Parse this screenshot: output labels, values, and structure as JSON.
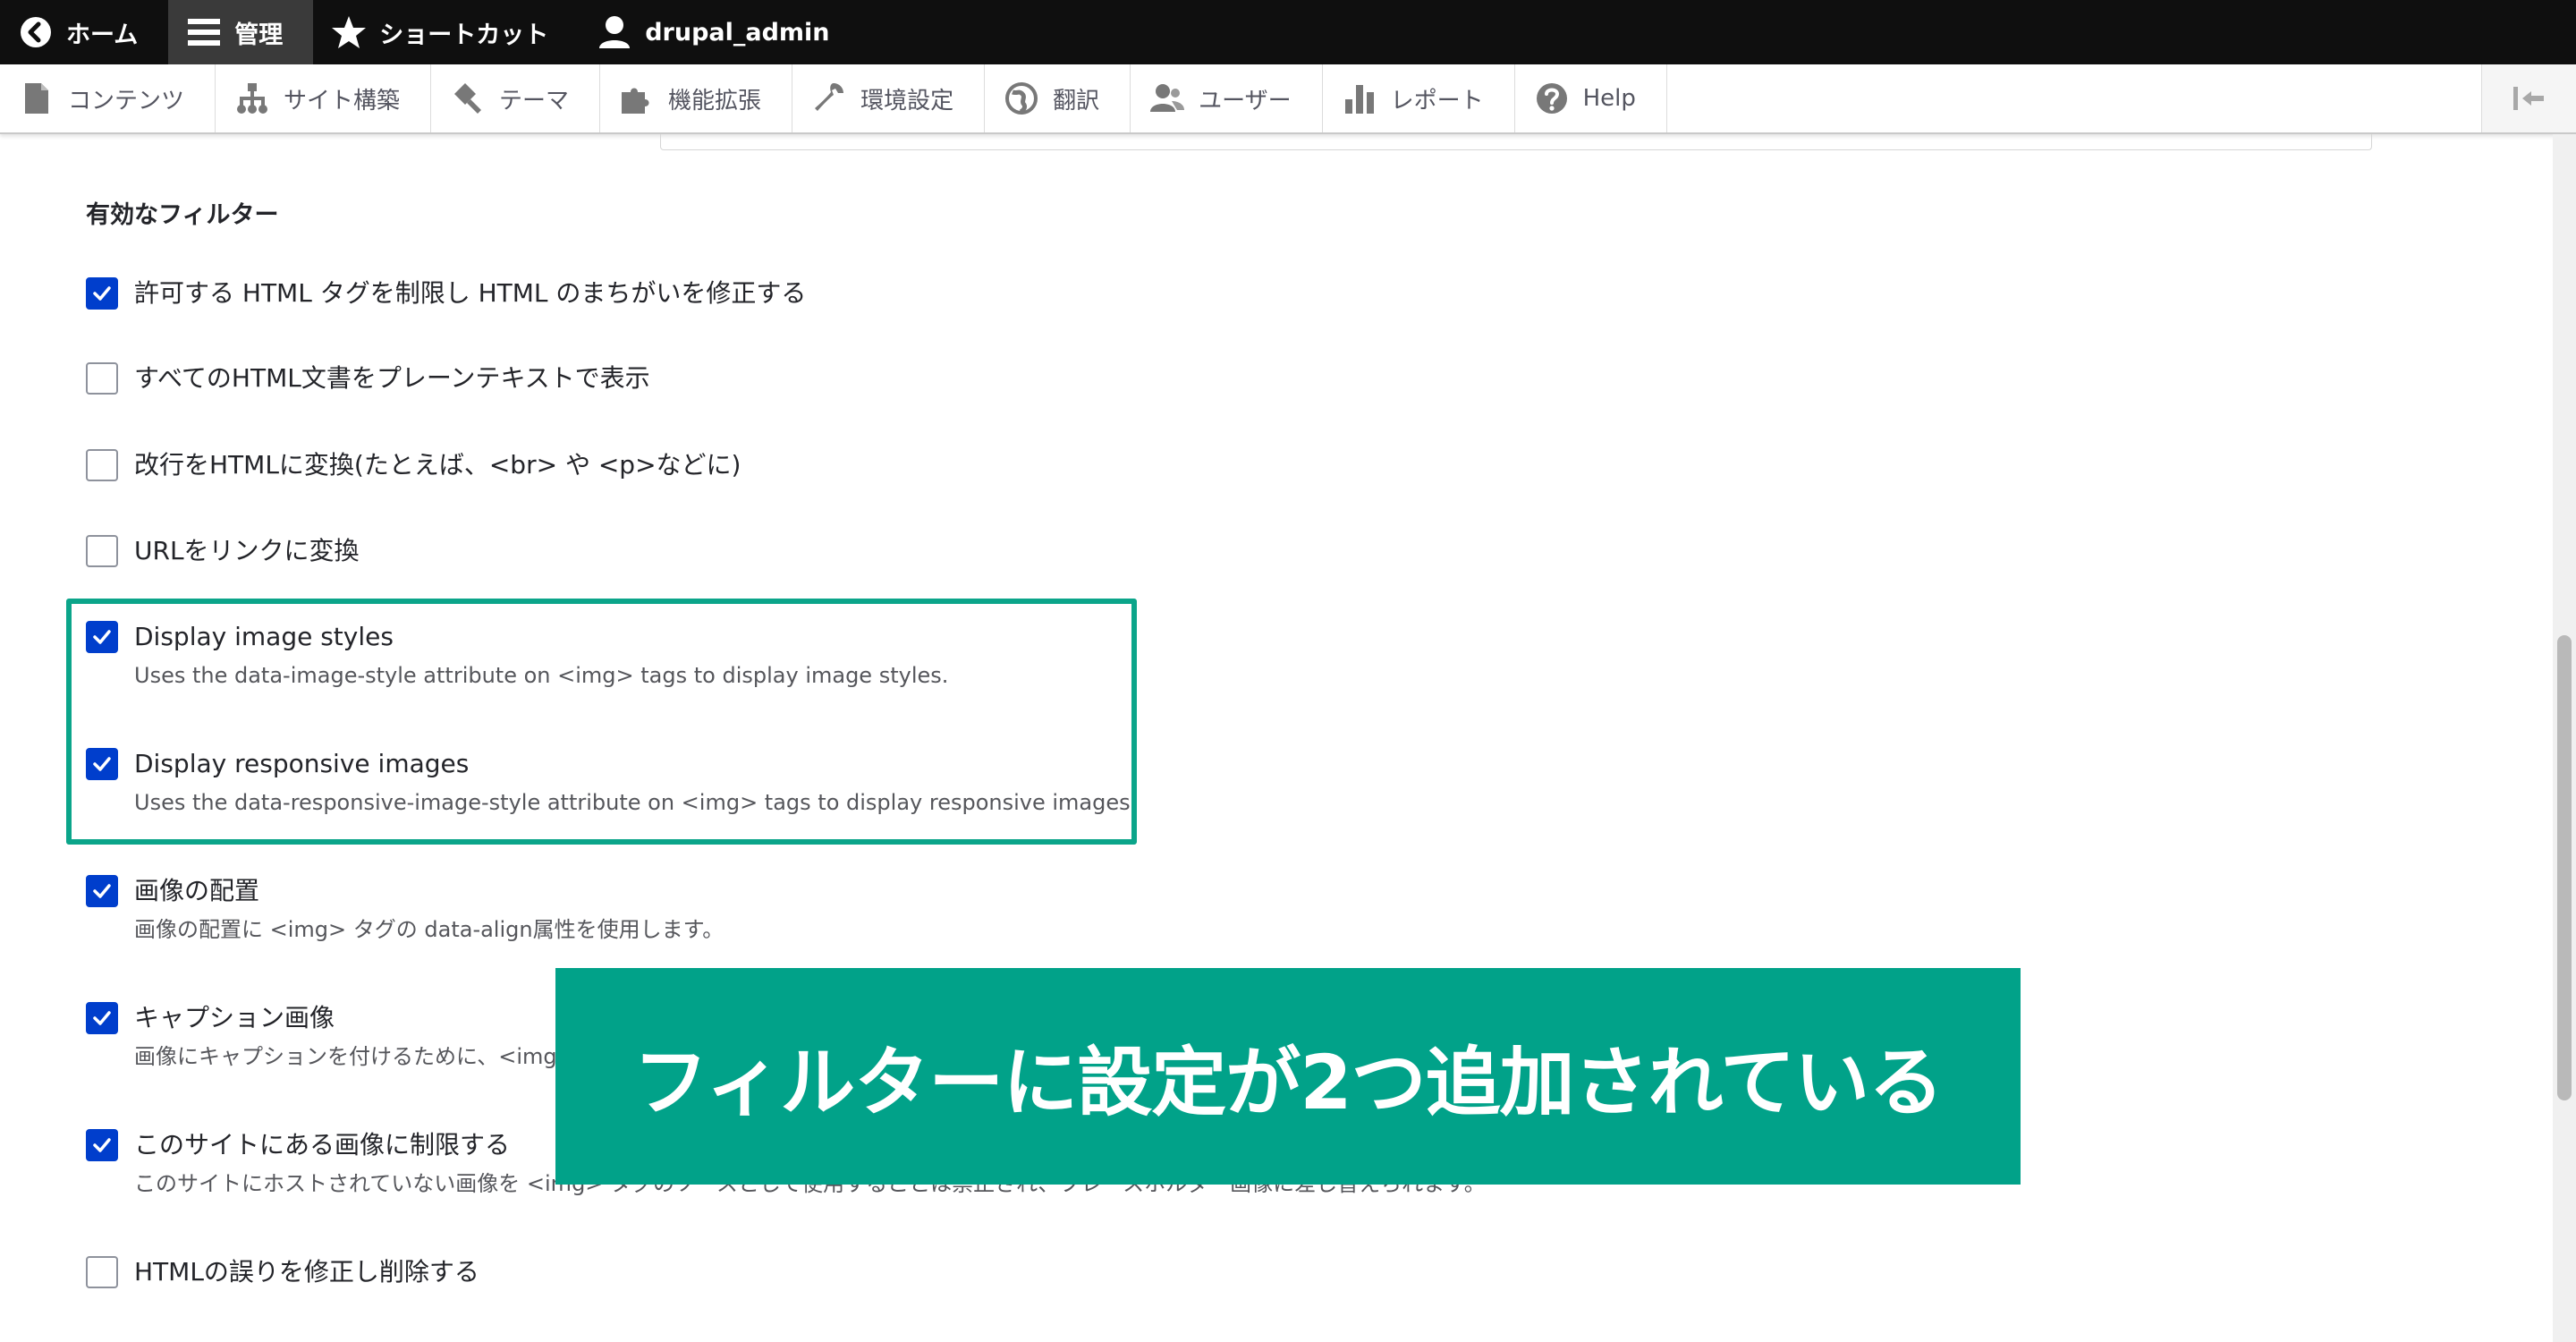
{
  "toolbar": {
    "items": [
      {
        "label": "ホーム",
        "icon": "back-arrow-icon"
      },
      {
        "label": "管理",
        "icon": "hamburger-menu-icon",
        "active": true
      },
      {
        "label": "ショートカット",
        "icon": "star-icon"
      },
      {
        "label": "drupal_admin",
        "icon": "user-icon"
      }
    ]
  },
  "tray": {
    "items": [
      {
        "label": "コンテンツ",
        "icon": "document-icon"
      },
      {
        "label": "サイト構築",
        "icon": "sitemap-icon"
      },
      {
        "label": "テーマ",
        "icon": "paint-roller-icon"
      },
      {
        "label": "機能拡張",
        "icon": "puzzle-icon"
      },
      {
        "label": "環境設定",
        "icon": "wrench-icon"
      },
      {
        "label": "翻訳",
        "icon": "globe-icon"
      },
      {
        "label": "ユーザー",
        "icon": "people-icon"
      },
      {
        "label": "レポート",
        "icon": "bar-chart-icon"
      },
      {
        "label": "Help",
        "icon": "help-icon"
      }
    ],
    "collapse_icon": "collapse-left-icon"
  },
  "section": {
    "title": "有効なフィルター"
  },
  "filters": [
    {
      "label": "許可する HTML タグを制限し HTML のまちがいを修正する",
      "checked": true
    },
    {
      "label": "すべてのHTML文書をプレーンテキストで表示",
      "checked": false
    },
    {
      "label": "改行をHTMLに変換(たとえば、<br> や <p>などに)",
      "checked": false
    },
    {
      "label": "URLをリンクに変換",
      "checked": false
    },
    {
      "label": "Display image styles",
      "checked": true,
      "description": "Uses the data-image-style attribute on <img> tags to display image styles."
    },
    {
      "label": "Display responsive images",
      "checked": true,
      "description": "Uses the data-responsive-image-style attribute on <img> tags to display responsive images."
    },
    {
      "label": "画像の配置",
      "checked": true,
      "description": "画像の配置に <img> タグの data-align属性を使用します。"
    },
    {
      "label": "キャプション画像",
      "checked": true,
      "description": "画像にキャプションを付けるために、<img> タグの data-caption属性を使用します。"
    },
    {
      "label": "このサイトにある画像に制限する",
      "checked": true,
      "description": "このサイトにホストされていない画像を <img> タグのソースとして使用することは禁止され、プレースホルダー画像に差し替えられます。"
    },
    {
      "label": "HTMLの誤りを修正し削除する",
      "checked": false
    }
  ],
  "banner": {
    "text": "フィルターに設定が2つ追加されている"
  },
  "colors": {
    "accent": "#01a289",
    "checkbox": "#003ecc",
    "toolbar_bg": "#0f0f0f"
  }
}
